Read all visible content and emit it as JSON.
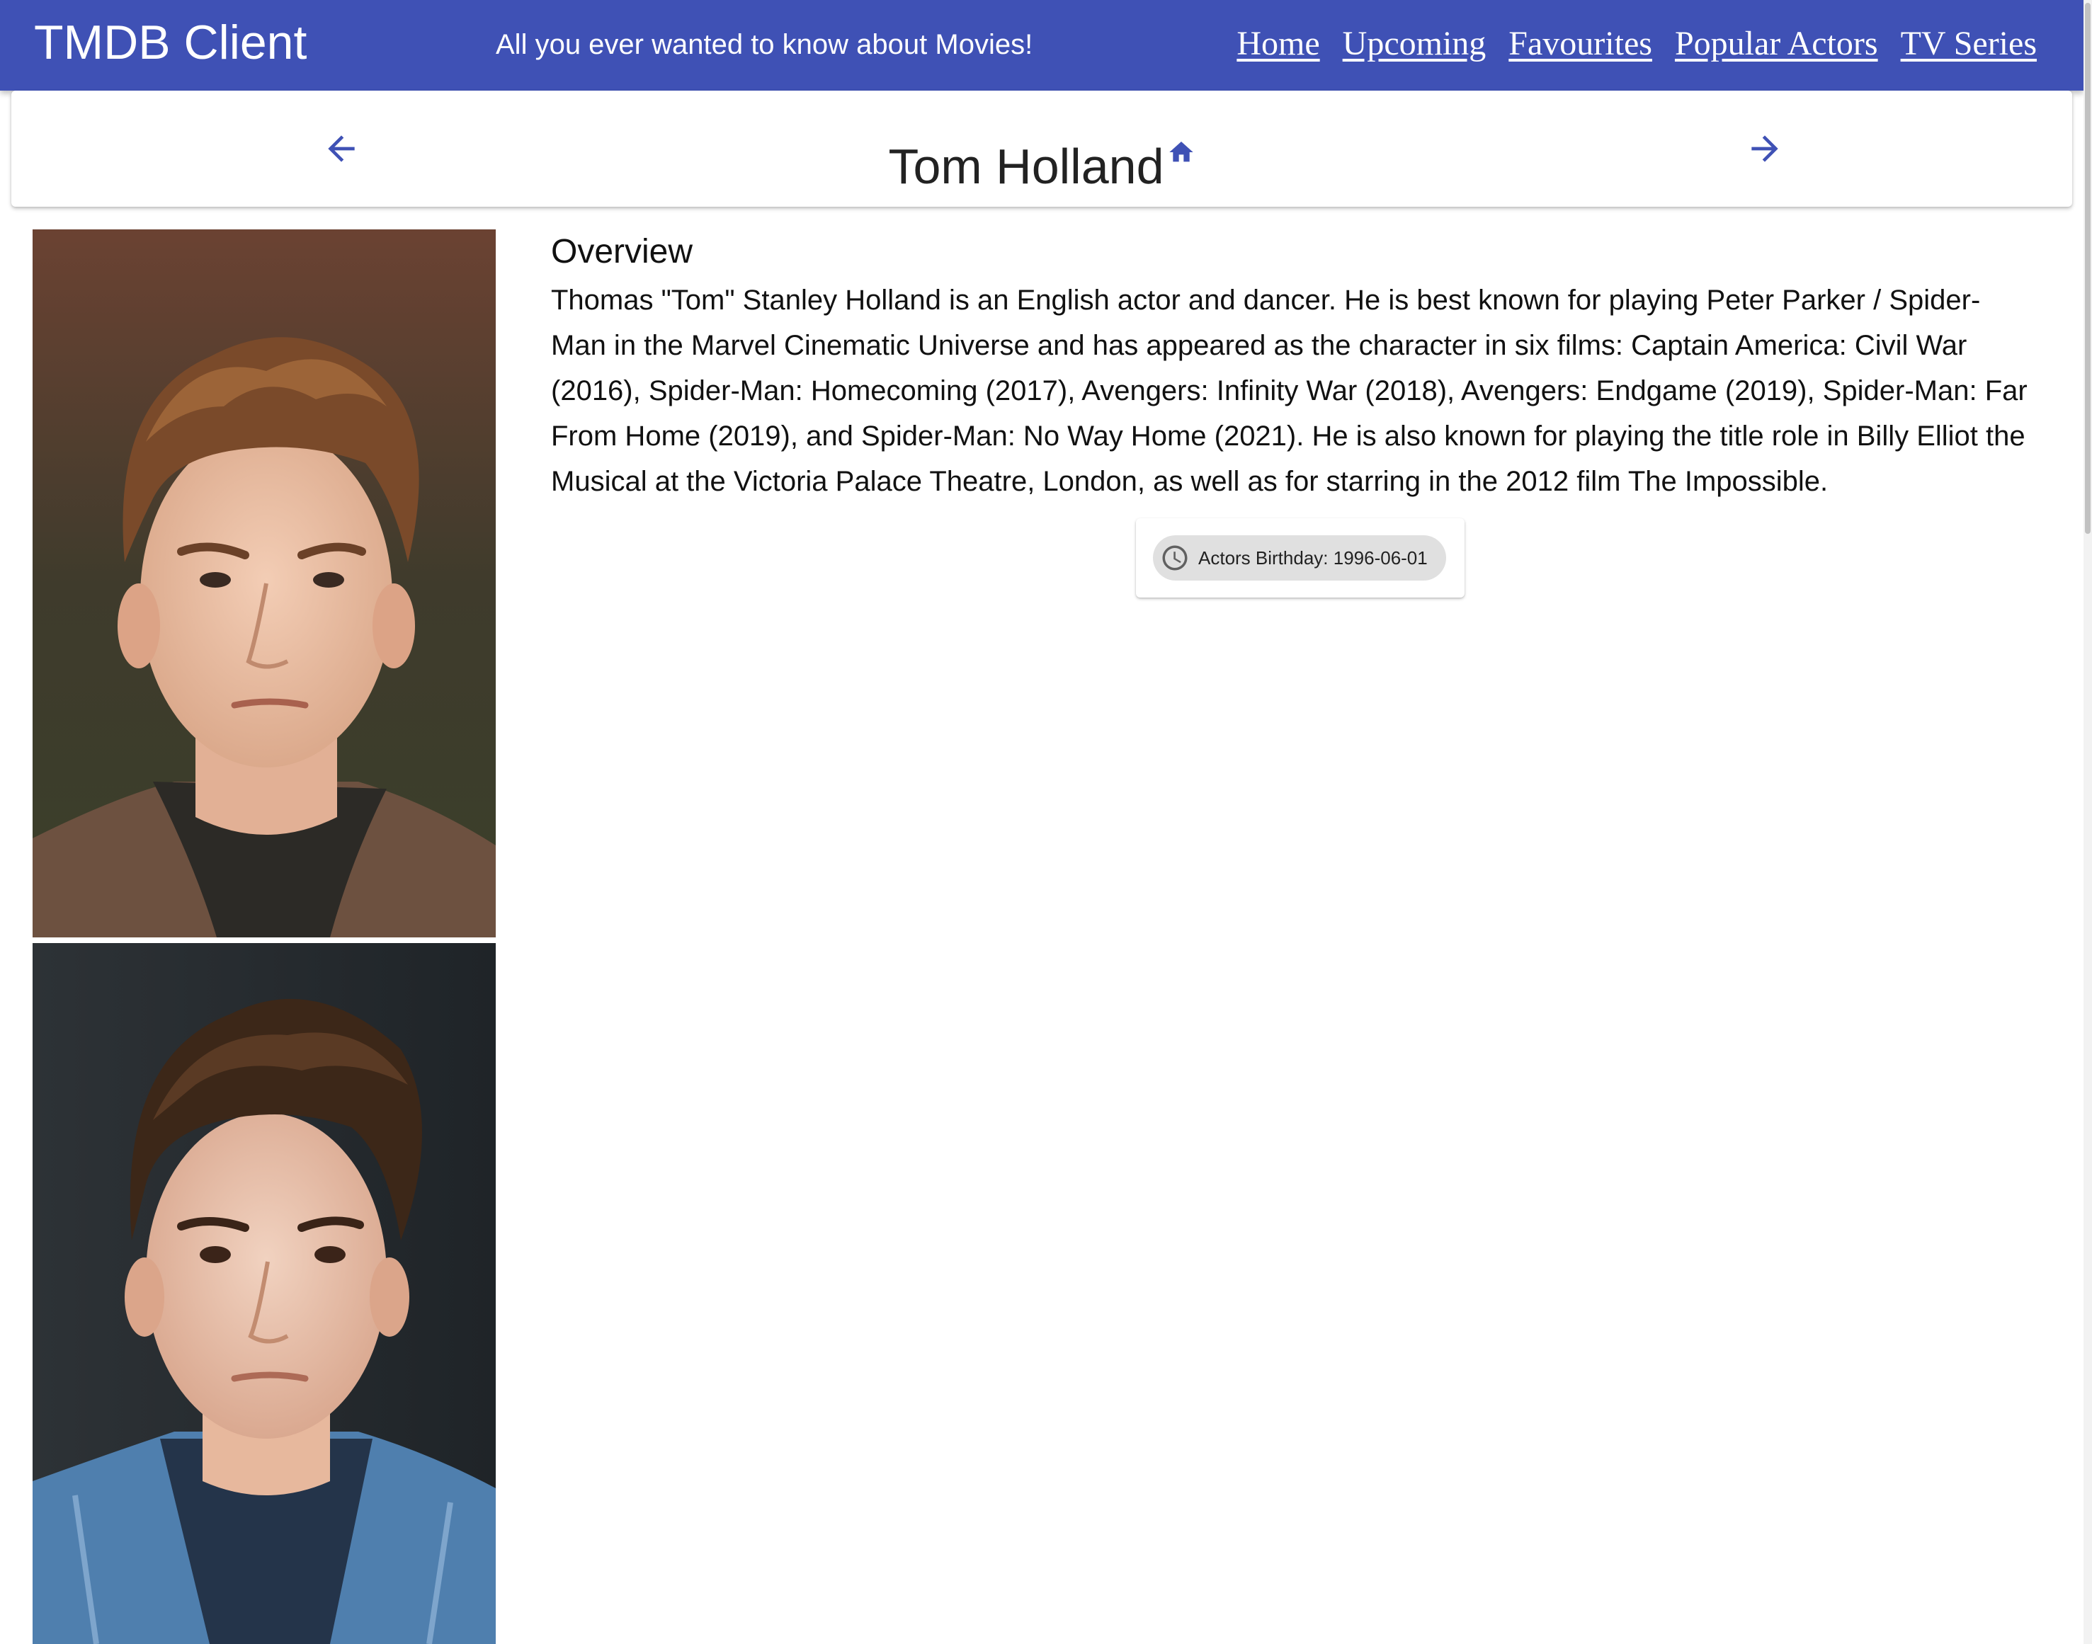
{
  "app": {
    "title": "TMDB Client",
    "tagline": "All you ever wanted to know about Movies!",
    "accent_color": "#3f51b5"
  },
  "nav": {
    "items": [
      {
        "label": "Home"
      },
      {
        "label": "Upcoming"
      },
      {
        "label": "Favourites"
      },
      {
        "label": "Popular Actors"
      },
      {
        "label": "TV Series"
      }
    ]
  },
  "header": {
    "title": "Tom Holland",
    "back_icon": "arrow-back-icon",
    "forward_icon": "arrow-forward-icon",
    "title_icon": "home-icon"
  },
  "actor": {
    "photos": [
      {
        "icon": "actor-portrait-photo"
      },
      {
        "icon": "actor-portrait-photo"
      }
    ],
    "overview_heading": "Overview",
    "overview": "Thomas \"Tom\" Stanley Holland is an English actor and dancer. He is best known for playing Peter Parker / Spider-Man in the Marvel Cinematic Universe and has appeared as the character in six films: Captain America: Civil War (2016), Spider-Man: Homecoming (2017), Avengers: Infinity War (2018), Avengers: Endgame (2019), Spider-Man: Far From Home (2019), and Spider-Man: No Way Home (2021). He is also known for playing the title role in Billy Elliot the Musical at the Victoria Palace Theatre, London, as well as for starring in the 2012 film The Impossible.",
    "birthday_chip": "Actors Birthday: 1996-06-01",
    "birthday_icon": "clock-icon"
  }
}
